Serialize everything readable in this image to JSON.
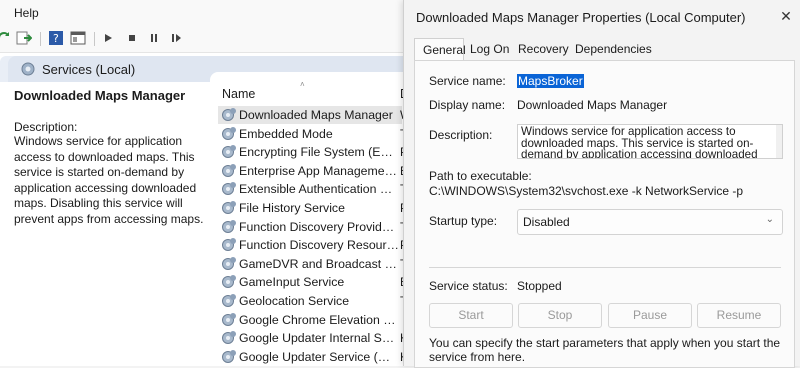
{
  "mmc": {
    "menu": {
      "help": "Help"
    },
    "header": {
      "title": "Services (Local)"
    },
    "left_pane": {
      "service_title": "Downloaded Maps Manager",
      "description_label": "Description:",
      "description": "Windows service for application access to downloaded maps. This service is started on-demand by application accessing downloaded maps. Disabling this service will prevent apps from accessing maps."
    },
    "columns": {
      "name": "Name",
      "d": "D"
    },
    "rows": [
      {
        "name": "Downloaded Maps Manager",
        "c2": "W"
      },
      {
        "name": "Embedded Mode",
        "c2": "Th"
      },
      {
        "name": "Encrypting File System (EFS)",
        "c2": "Pr"
      },
      {
        "name": "Enterprise App Managemen...",
        "c2": "Er"
      },
      {
        "name": "Extensible Authentication Pr...",
        "c2": "Th"
      },
      {
        "name": "File History Service",
        "c2": "Pr"
      },
      {
        "name": "Function Discovery Provider ...",
        "c2": "Th"
      },
      {
        "name": "Function Discovery Resourc...",
        "c2": "Pu"
      },
      {
        "name": "GameDVR and Broadcast Us...",
        "c2": "Th"
      },
      {
        "name": "GameInput Service",
        "c2": "Er"
      },
      {
        "name": "Geolocation Service",
        "c2": "Th"
      },
      {
        "name": "Google Chrome Elevation Se...",
        "c2": ""
      },
      {
        "name": "Google Updater Internal Ser...",
        "c2": "Ki"
      },
      {
        "name": "Google Updater Service (Go...",
        "c2": "Ki"
      }
    ]
  },
  "dialog": {
    "title": "Downloaded Maps Manager Properties (Local Computer)",
    "tabs": [
      "General",
      "Log On",
      "Recovery",
      "Dependencies"
    ],
    "active_tab": "General",
    "service_name_label": "Service name:",
    "service_name": "MapsBroker",
    "display_name_label": "Display name:",
    "display_name": "Downloaded Maps Manager",
    "description_label": "Description:",
    "description": "Windows service for application access to downloaded maps. This service is started on-demand by application accessing downloaded maps",
    "path_label": "Path to executable:",
    "path": "C:\\WINDOWS\\System32\\svchost.exe -k NetworkService -p",
    "startup_label": "Startup type:",
    "startup_value": "Disabled",
    "status_label": "Service status:",
    "status_value": "Stopped",
    "buttons": {
      "start": "Start",
      "stop": "Stop",
      "pause": "Pause",
      "resume": "Resume"
    },
    "help": "You can specify the start parameters that apply when you start the service from here."
  },
  "colors": {
    "selection": "#0a64d6",
    "header_band": "#dfe6f1",
    "selected_row": "#e6e6e6"
  }
}
